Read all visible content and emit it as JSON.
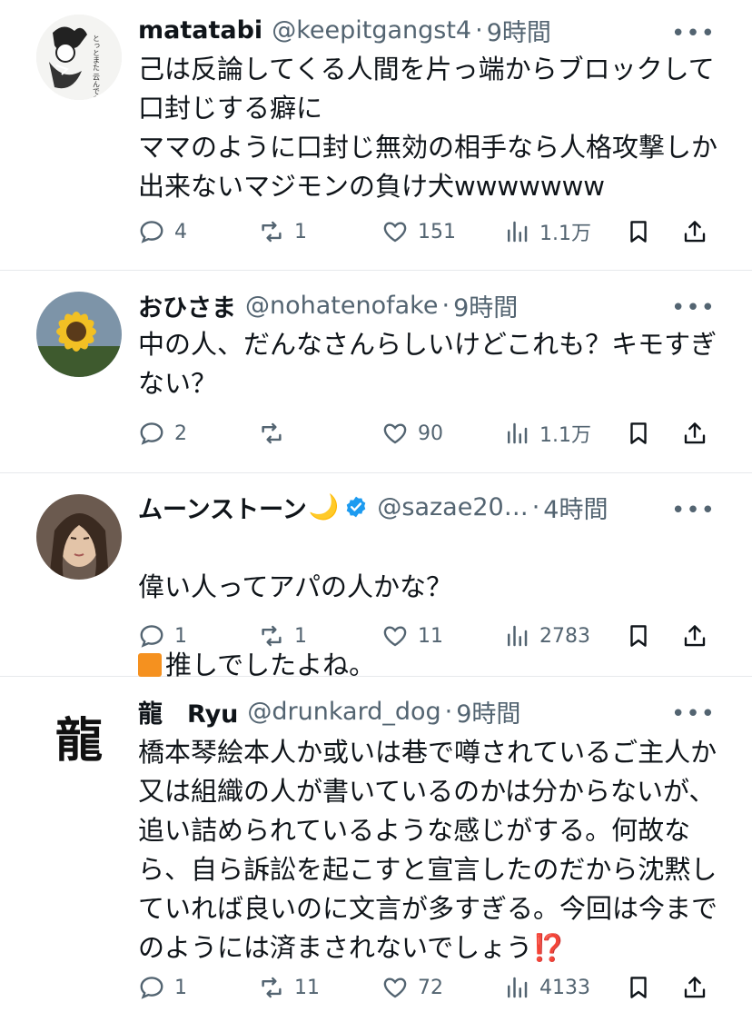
{
  "posts": [
    {
      "name": "matatabi",
      "handle": "@keepitgangst4",
      "sep": "·",
      "time": "9時間",
      "more": "•••",
      "text": "己は反論してくる人間を片っ端からブロックして口封じする癖に\nママのように口封じ無効の相手なら人格攻撃しか出来ないマジモンの負け犬wwwwwww",
      "replies": "4",
      "reposts": "1",
      "likes": "151",
      "views": "1.1万",
      "avatar_text": "とっとまた 云んでも 云とこと 驚子のか打"
    },
    {
      "name": "おひさま",
      "handle": "@nohatenofake",
      "sep": "·",
      "time": "9時間",
      "more": "•••",
      "text": "中の人、だんなさんらしいけどこれも？キモすぎない？",
      "replies": "2",
      "reposts": "",
      "likes": "90",
      "views": "1.1万"
    },
    {
      "name": "ムーンストーン",
      "name_emoji": "🌙",
      "handle": "@sazae20…",
      "sep": "·",
      "time": "4時間",
      "more": "•••",
      "text_line1": "偉い人ってアパの人かな？",
      "text_line2": "推しでしたよね。",
      "replies": "1",
      "reposts": "1",
      "likes": "11",
      "views": "2783"
    },
    {
      "name": "龍　Ryu",
      "handle": "@drunkard_dog",
      "sep": "·",
      "time": "9時間",
      "more": "•••",
      "text": "橋本琴絵本人か或いは巷で噂されているご主人か又は組織の人が書いているのかは分からないが、追い詰められているような感じがする。何故なら、自ら訴訟を起こすと宣言したのだから沈黙していれば良いのに文言が多すぎる。今回は今までのようには済まされないでしょう",
      "text_end": "⁉️",
      "replies": "1",
      "reposts": "11",
      "likes": "72",
      "views": "4133",
      "avatar_text": "龍"
    }
  ],
  "colors": {
    "text": "#0f1419",
    "muted": "#536471",
    "divider": "#e7e9ec",
    "verified": "#1d9bf0"
  }
}
